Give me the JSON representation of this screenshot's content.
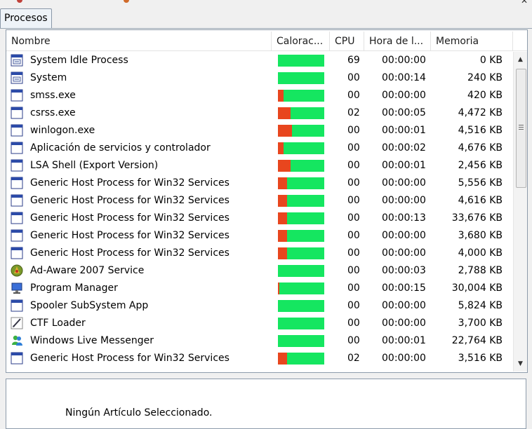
{
  "tabs": [
    {
      "label": "Procesos"
    }
  ],
  "columns": {
    "name": "Nombre",
    "heat": "Calorac...",
    "cpu": "CPU",
    "time": "Hora de l...",
    "memory": "Memoria"
  },
  "processes": [
    {
      "name": "System Idle Process",
      "icon": "system-window-icon",
      "cpu": "69",
      "time": "00:00:00",
      "memory": "0 KB",
      "heat_fraction": 0.0
    },
    {
      "name": "System",
      "icon": "system-window-icon",
      "cpu": "00",
      "time": "00:00:14",
      "memory": "240 KB",
      "heat_fraction": 0.0
    },
    {
      "name": "smss.exe",
      "icon": "window-icon",
      "cpu": "00",
      "time": "00:00:00",
      "memory": "420 KB",
      "heat_fraction": 0.12
    },
    {
      "name": "csrss.exe",
      "icon": "window-icon",
      "cpu": "02",
      "time": "00:00:05",
      "memory": "4,472 KB",
      "heat_fraction": 0.27
    },
    {
      "name": "winlogon.exe",
      "icon": "window-icon",
      "cpu": "00",
      "time": "00:00:01",
      "memory": "4,516 KB",
      "heat_fraction": 0.3
    },
    {
      "name": "Aplicación de servicios y controlador",
      "icon": "window-icon",
      "cpu": "00",
      "time": "00:00:02",
      "memory": "4,676 KB",
      "heat_fraction": 0.12
    },
    {
      "name": "LSA Shell (Export Version)",
      "icon": "window-icon",
      "cpu": "00",
      "time": "00:00:01",
      "memory": "2,456 KB",
      "heat_fraction": 0.27
    },
    {
      "name": "Generic Host Process for Win32 Services",
      "icon": "window-icon",
      "cpu": "00",
      "time": "00:00:00",
      "memory": "5,556 KB",
      "heat_fraction": 0.2
    },
    {
      "name": "Generic Host Process for Win32 Services",
      "icon": "window-icon",
      "cpu": "00",
      "time": "00:00:00",
      "memory": "4,616 KB",
      "heat_fraction": 0.2
    },
    {
      "name": "Generic Host Process for Win32 Services",
      "icon": "window-icon",
      "cpu": "00",
      "time": "00:00:13",
      "memory": "33,676 KB",
      "heat_fraction": 0.2
    },
    {
      "name": "Generic Host Process for Win32 Services",
      "icon": "window-icon",
      "cpu": "00",
      "time": "00:00:00",
      "memory": "3,680 KB",
      "heat_fraction": 0.2
    },
    {
      "name": "Generic Host Process for Win32 Services",
      "icon": "window-icon",
      "cpu": "00",
      "time": "00:00:00",
      "memory": "4,000 KB",
      "heat_fraction": 0.2
    },
    {
      "name": "Ad-Aware 2007 Service",
      "icon": "ad-aware-icon",
      "cpu": "00",
      "time": "00:00:03",
      "memory": "2,788 KB",
      "heat_fraction": 0.0
    },
    {
      "name": "Program Manager",
      "icon": "monitor-icon",
      "cpu": "00",
      "time": "00:00:15",
      "memory": "30,004 KB",
      "heat_fraction": 0.03
    },
    {
      "name": "Spooler SubSystem App",
      "icon": "window-icon",
      "cpu": "00",
      "time": "00:00:00",
      "memory": "5,824 KB",
      "heat_fraction": 0.0
    },
    {
      "name": "CTF Loader",
      "icon": "pen-icon",
      "cpu": "00",
      "time": "00:00:00",
      "memory": "3,700 KB",
      "heat_fraction": 0.0
    },
    {
      "name": "Windows Live Messenger",
      "icon": "messenger-icon",
      "cpu": "00",
      "time": "00:00:01",
      "memory": "22,764 KB",
      "heat_fraction": 0.0
    },
    {
      "name": "Generic Host Process for Win32 Services",
      "icon": "window-icon",
      "cpu": "02",
      "time": "00:00:00",
      "memory": "3,516 KB",
      "heat_fraction": 0.2
    }
  ],
  "details": {
    "empty_message": "Ningún Artículo Seleccionado."
  },
  "colors": {
    "heat_low": "#15e660",
    "heat_high": "#e8461e"
  }
}
